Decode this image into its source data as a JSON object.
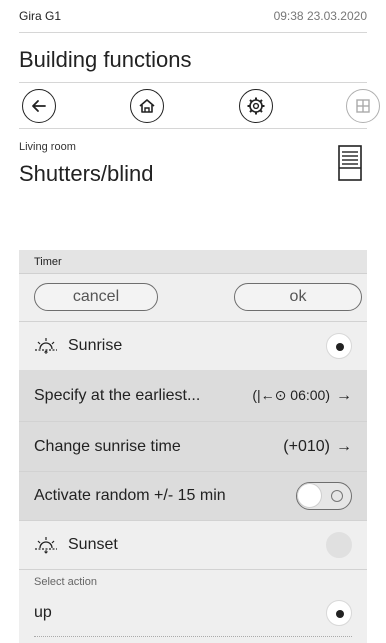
{
  "status_bar": {
    "device": "Gira G1",
    "datetime": "09:38 23.03.2020"
  },
  "header": {
    "title": "Building functions"
  },
  "nav": {
    "back_icon": "back-arrow-icon",
    "home_icon": "home-icon",
    "settings_icon": "settings-gear-icon",
    "grid_icon": "grid-icon"
  },
  "function": {
    "room": "Living room",
    "title": "Shutters/blind",
    "icon": "blind-icon"
  },
  "timer": {
    "header": "Timer",
    "cancel_label": "cancel",
    "ok_label": "ok",
    "sunrise": {
      "label": "Sunrise",
      "selected": true
    },
    "earliest": {
      "label": "Specify at the earliest...",
      "value": "(|←⊙ 06:00)"
    },
    "change_time": {
      "label": "Change sunrise time",
      "value": "(+010)"
    },
    "random": {
      "label": "Activate random +/- 15 min",
      "enabled": false
    },
    "sunset": {
      "label": "Sunset",
      "selected": false
    },
    "action": {
      "section_label": "Select action",
      "value": "up",
      "selected": true
    },
    "arrow": "→"
  }
}
